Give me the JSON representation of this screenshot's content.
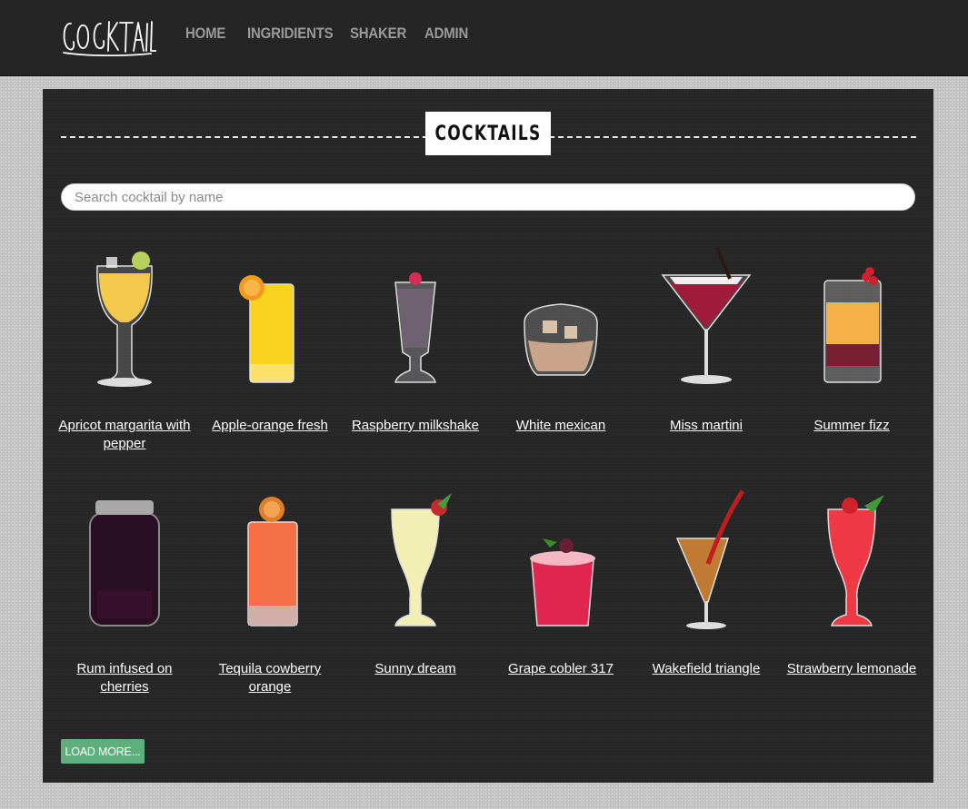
{
  "header": {
    "logo_text": "COCKTAIL",
    "nav": [
      "HOME",
      "INGRIDIENTS",
      "SHAKER",
      "ADMIN"
    ]
  },
  "main": {
    "title": "COCKTAILS",
    "search_placeholder": "Search cocktail by name",
    "load_more_label": "LOAD MORE...",
    "cocktails": [
      {
        "name": "Apricot margarita with pepper",
        "icon": "tulip-glass-yellow-icon",
        "color": "#f2c94c"
      },
      {
        "name": "Apple-orange fresh",
        "icon": "highball-glass-orange-icon",
        "color": "#f7d21e"
      },
      {
        "name": "Raspberry milkshake",
        "icon": "milkshake-glass-icon",
        "color": "#6f6270"
      },
      {
        "name": "White mexican",
        "icon": "rocks-glass-icon",
        "color": "#c8a58a"
      },
      {
        "name": "Miss martini",
        "icon": "martini-glass-icon",
        "color": "#a01c3c"
      },
      {
        "name": "Summer fizz",
        "icon": "layered-glass-icon",
        "color": "#f5b04a"
      },
      {
        "name": "Rum infused on cherries",
        "icon": "jar-icon",
        "color": "#2a0f24"
      },
      {
        "name": "Tequila cowberry orange",
        "icon": "highball-glass-red-icon",
        "color": "#f57045"
      },
      {
        "name": "Sunny dream",
        "icon": "hurricane-glass-cream-icon",
        "color": "#f1efb4"
      },
      {
        "name": "Grape cobler 317",
        "icon": "cobbler-glass-icon",
        "color": "#e1264f"
      },
      {
        "name": "Wakefield triangle",
        "icon": "cone-glass-icon",
        "color": "#c07a34"
      },
      {
        "name": "Strawberry lemonade",
        "icon": "hurricane-glass-red-icon",
        "color": "#ef3945"
      }
    ]
  }
}
